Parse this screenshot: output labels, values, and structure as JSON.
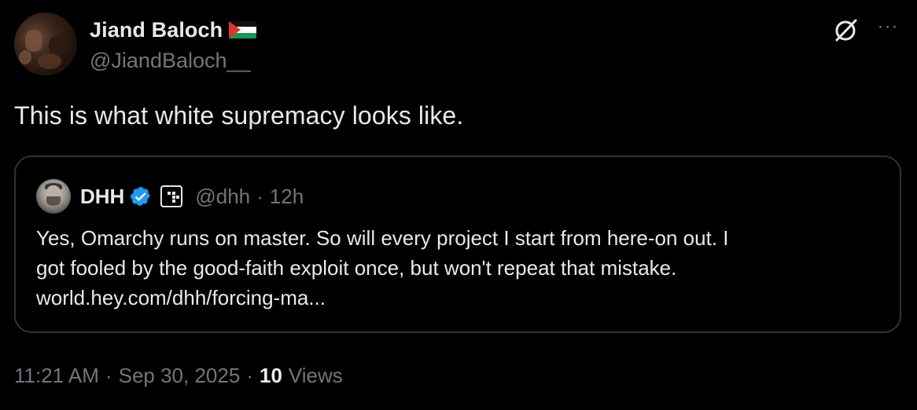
{
  "author": {
    "display_name": "Jiand Baloch",
    "flag_emoji": "🇵🇸",
    "handle": "@JiandBaloch__",
    "avatar_icon": "profile-photo"
  },
  "actions": {
    "grok_icon": "grok-icon",
    "more_icon": "more-icon",
    "more_label": "···"
  },
  "tweet": {
    "text": "This is what white supremacy looks like."
  },
  "quoted": {
    "display_name": "DHH",
    "verified_icon": "verified-badge-icon",
    "affiliate_icon": "affiliate-badge-icon",
    "handle": "@dhh",
    "separator": "·",
    "time": "12h",
    "lines": [
      "Yes, Omarchy runs on master. So will every project I start from here-on out. I",
      "got fooled by the good-faith exploit once, but won't repeat that mistake.",
      "world.hey.com/dhh/forcing-ma..."
    ]
  },
  "meta": {
    "time": "11:21 AM",
    "separator1": "·",
    "date": "Sep 30, 2025",
    "separator2": "·",
    "views_count": "10",
    "views_label": "Views"
  },
  "colors": {
    "background": "#000000",
    "text": "#e7e9ea",
    "muted": "#71767b",
    "border": "#2f3336",
    "verified": "#1d9bf0"
  }
}
